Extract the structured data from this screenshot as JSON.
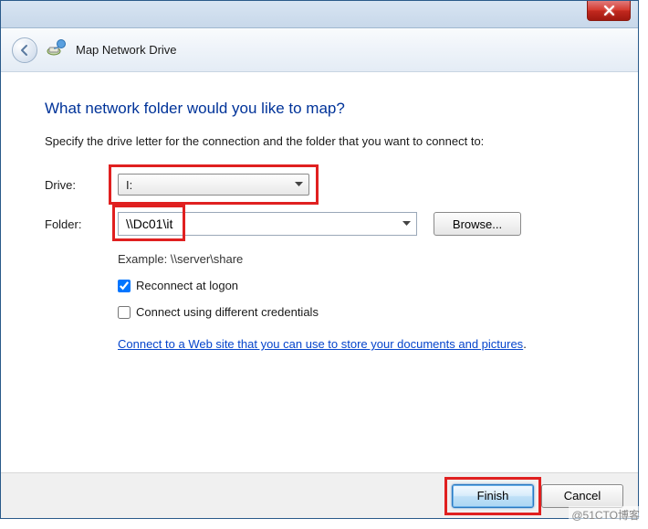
{
  "window": {
    "title": "Map Network Drive"
  },
  "content": {
    "heading": "What network folder would you like to map?",
    "instruction": "Specify the drive letter for the connection and the folder that you want to connect to:",
    "drive_label": "Drive:",
    "drive_value": "I:",
    "folder_label": "Folder:",
    "folder_value": "\\\\Dc01\\it",
    "browse_label": "Browse...",
    "example_text": "Example: \\\\server\\share",
    "reconnect_label": "Reconnect at logon",
    "reconnect_checked": true,
    "credentials_label": "Connect using different credentials",
    "credentials_checked": false,
    "link_text": "Connect to a Web site that you can use to store your documents and pictures"
  },
  "footer": {
    "finish_label": "Finish",
    "cancel_label": "Cancel"
  },
  "watermark": "@51CTO博客"
}
